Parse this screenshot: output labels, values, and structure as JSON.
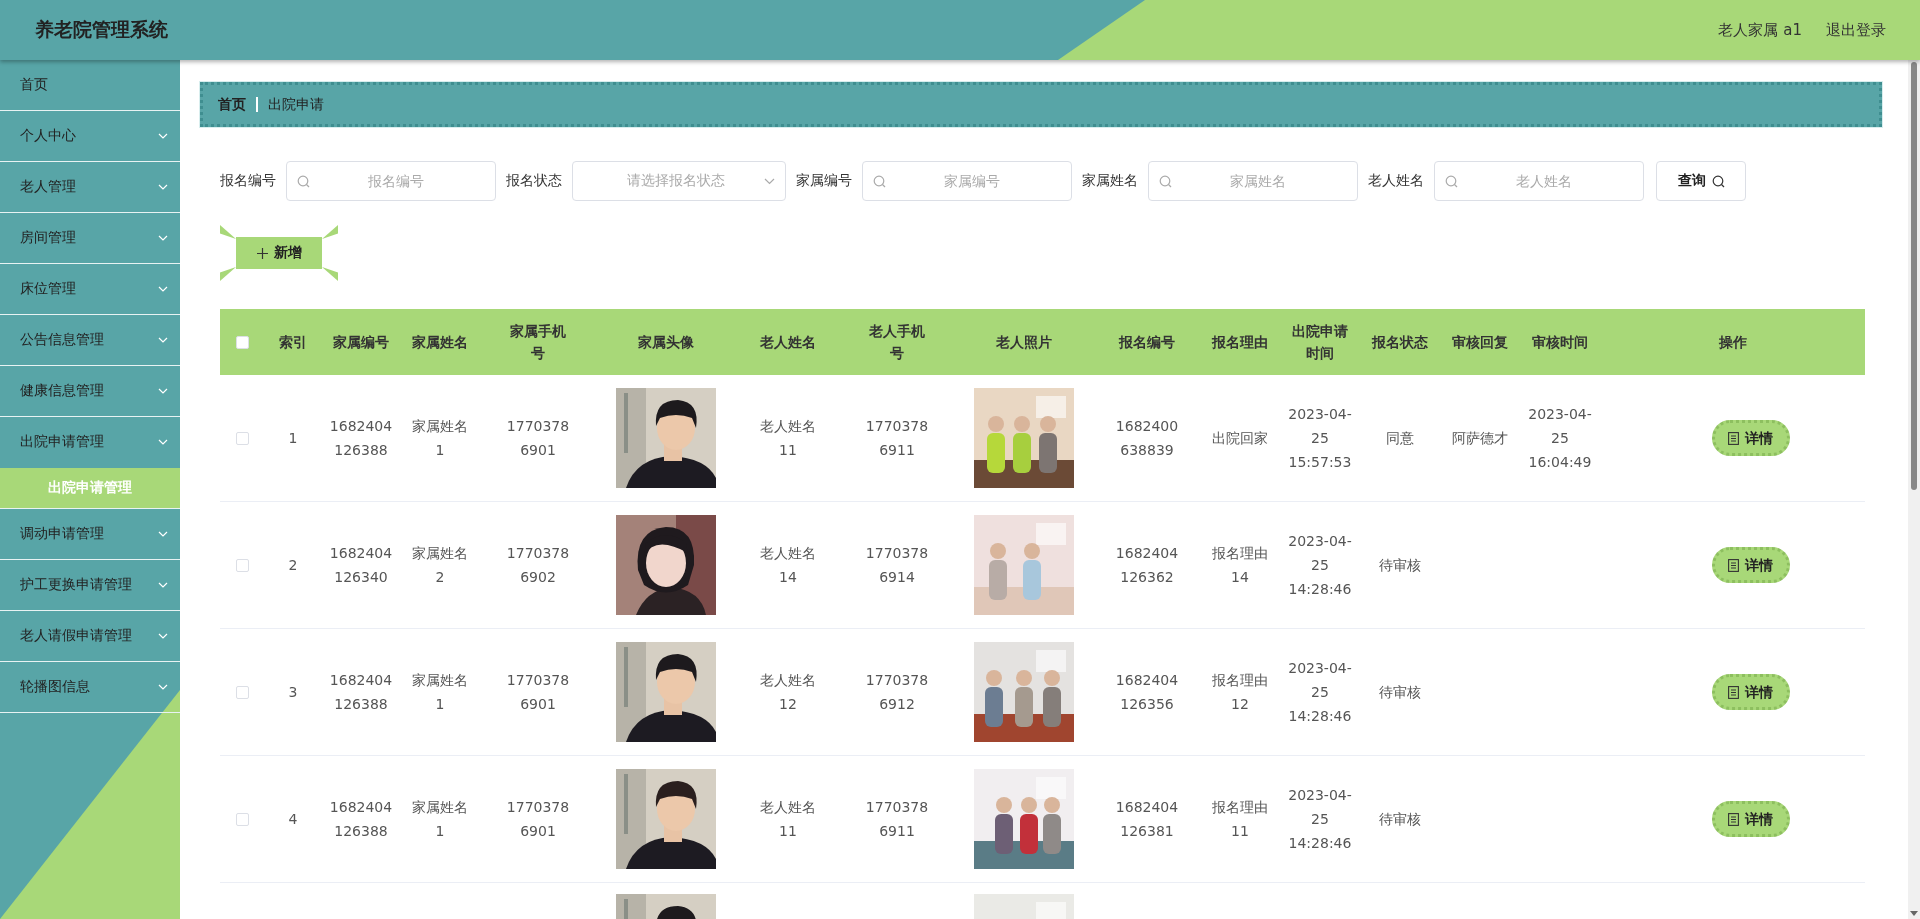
{
  "header": {
    "title": "养老院管理系统",
    "user": "老人家属 a1",
    "logout": "退出登录"
  },
  "sidebar": {
    "items": [
      {
        "label": "首页",
        "expandable": false,
        "expanded": false
      },
      {
        "label": "个人中心",
        "expandable": true,
        "expanded": false
      },
      {
        "label": "老人管理",
        "expandable": true,
        "expanded": false
      },
      {
        "label": "房间管理",
        "expandable": true,
        "expanded": false
      },
      {
        "label": "床位管理",
        "expandable": true,
        "expanded": false
      },
      {
        "label": "公告信息管理",
        "expandable": true,
        "expanded": false
      },
      {
        "label": "健康信息管理",
        "expandable": true,
        "expanded": false
      },
      {
        "label": "出院申请管理",
        "expandable": true,
        "expanded": true,
        "children": [
          {
            "label": "出院申请管理",
            "selected": true
          }
        ]
      },
      {
        "label": "调动申请管理",
        "expandable": true,
        "expanded": false
      },
      {
        "label": "护工更换申请管理",
        "expandable": true,
        "expanded": false
      },
      {
        "label": "老人请假申请管理",
        "expandable": true,
        "expanded": false
      },
      {
        "label": "轮播图信息",
        "expandable": true,
        "expanded": false
      }
    ]
  },
  "breadcrumb": [
    "首页",
    "出院申请"
  ],
  "search": {
    "fields": [
      {
        "label": "报名编号",
        "kind": "input",
        "placeholder": "报名编号"
      },
      {
        "label": "报名状态",
        "kind": "select",
        "placeholder": "请选择报名状态"
      },
      {
        "label": "家属编号",
        "kind": "input",
        "placeholder": "家属编号"
      },
      {
        "label": "家属姓名",
        "kind": "input",
        "placeholder": "家属姓名"
      },
      {
        "label": "老人姓名",
        "kind": "input",
        "placeholder": "老人姓名"
      }
    ],
    "button": "查询"
  },
  "add_button": "新增",
  "table": {
    "header_checked": false,
    "columns": [
      "索引",
      "家属编号",
      "家属姓名",
      "家属手机号",
      "家属头像",
      "老人姓名",
      "老人手机号",
      "老人照片",
      "报名编号",
      "报名理由",
      "出院申请时间",
      "报名状态",
      "审核回复",
      "审核时间",
      "操作"
    ],
    "rows": [
      {
        "kind": "full",
        "checked": false,
        "index": "1",
        "family_no": "1682404126388",
        "family_name": "家属姓名1",
        "family_phone": "17703786901",
        "elder_name": "老人姓名11",
        "elder_phone": "17703786911",
        "apply_no": "1682400638839",
        "reason": "出院回家",
        "apply_time": "2023-04-25 15:57:53",
        "status": "同意",
        "reply": "阿萨德才",
        "review_time": "2023-04-25 16:04:49",
        "action": "详情"
      },
      {
        "kind": "full",
        "checked": false,
        "index": "2",
        "family_no": "1682404126340",
        "family_name": "家属姓名2",
        "family_phone": "17703786902",
        "elder_name": "老人姓名14",
        "elder_phone": "17703786914",
        "apply_no": "1682404126362",
        "reason": "报名理由14",
        "apply_time": "2023-04-25 14:28:46",
        "status": "待审核",
        "action": "详情"
      },
      {
        "kind": "full",
        "checked": false,
        "index": "3",
        "family_no": "1682404126388",
        "family_name": "家属姓名1",
        "family_phone": "17703786901",
        "elder_name": "老人姓名12",
        "elder_phone": "17703786912",
        "apply_no": "1682404126356",
        "reason": "报名理由12",
        "apply_time": "2023-04-25 14:28:46",
        "status": "待审核",
        "action": "详情"
      },
      {
        "kind": "full",
        "checked": false,
        "index": "4",
        "family_no": "1682404126388",
        "family_name": "家属姓名1",
        "family_phone": "17703786901",
        "elder_name": "老人姓名11",
        "elder_phone": "17703786911",
        "apply_no": "1682404126381",
        "reason": "报名理由11",
        "apply_time": "2023-04-25 14:28:46",
        "status": "待审核",
        "action": "详情"
      },
      {
        "kind": "cut"
      }
    ]
  }
}
